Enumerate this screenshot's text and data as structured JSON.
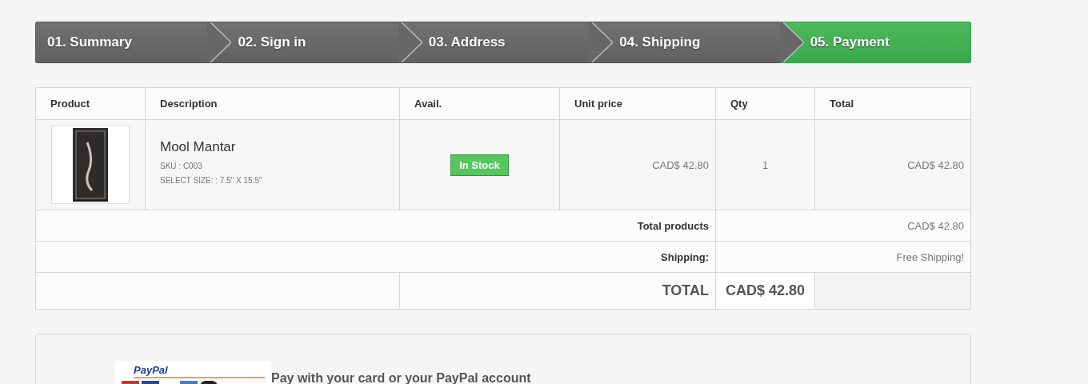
{
  "steps": [
    {
      "label": "01. Summary",
      "selected": false
    },
    {
      "label": "02. Sign in",
      "selected": false
    },
    {
      "label": "03. Address",
      "selected": false
    },
    {
      "label": "04. Shipping",
      "selected": false
    },
    {
      "label": "05. Payment",
      "selected": true
    }
  ],
  "table": {
    "columns": [
      "Product",
      "Description",
      "Avail.",
      "Unit price",
      "Qty",
      "Total"
    ],
    "rows": [
      {
        "name": "Mool Mantar",
        "sku": "SKU : C003",
        "size": "SELECT SIZE: : 7.5\" X 15.5\"",
        "availability": "In Stock",
        "unit_price": "CAD$ 42.80",
        "qty": "1",
        "total": "CAD$ 42.80"
      }
    ],
    "total_products": {
      "label": "Total products",
      "value": "CAD$ 42.80"
    },
    "shipping": {
      "label": "Shipping:",
      "value": "Free Shipping!"
    },
    "grand_total": {
      "label": "TOTAL",
      "value": "CAD$ 42.80"
    }
  },
  "payment": {
    "logo_text": "PayPal",
    "option": "Pay with your card or your PayPal account"
  }
}
